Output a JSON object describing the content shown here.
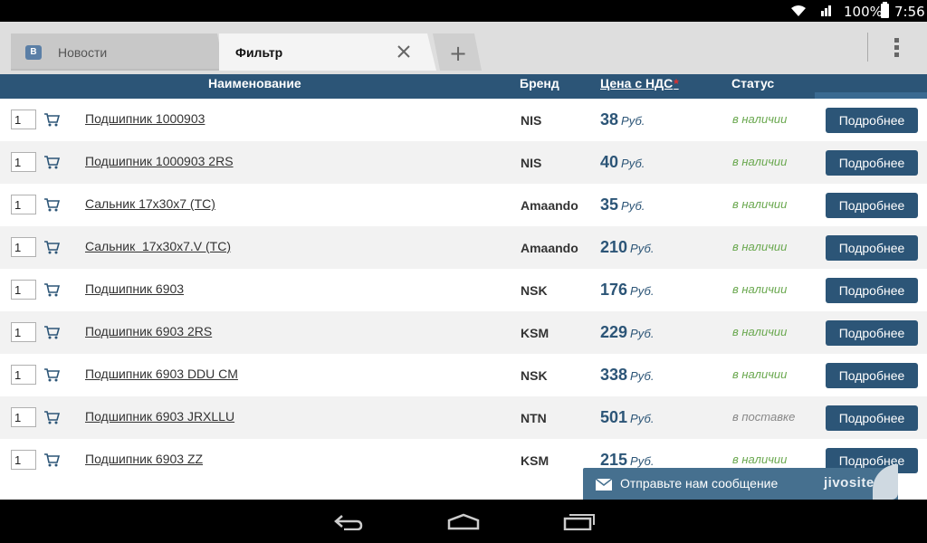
{
  "status_bar": {
    "battery": "100%",
    "time": "7:56"
  },
  "tabs": [
    {
      "label": "Новости",
      "icon": "vk-icon",
      "icon_letter": "В"
    },
    {
      "label": "Фильтр"
    }
  ],
  "table": {
    "headers": {
      "name": "Наименование",
      "brand": "Бренд",
      "price": "Цена с НДС",
      "price_mark": "*",
      "status": "Статус"
    },
    "currency": "Руб.",
    "more_label": "Подробнее",
    "rows": [
      {
        "qty": "1",
        "name": "Подшипник 1000903",
        "brand": "NIS",
        "price": "38",
        "status": "в наличии"
      },
      {
        "qty": "1",
        "name": "Подшипник 1000903 2RS",
        "brand": "NIS",
        "price": "40",
        "status": "в наличии"
      },
      {
        "qty": "1",
        "name": "Сальник 17х30х7 (TC)",
        "brand": "Amaando",
        "price": "35",
        "status": "в наличии"
      },
      {
        "qty": "1",
        "name": "Сальник  17х30х7.V (TC)",
        "brand": "Amaando",
        "price": "210",
        "status": "в наличии"
      },
      {
        "qty": "1",
        "name": "Подшипник 6903",
        "brand": "NSK",
        "price": "176",
        "status": "в наличии"
      },
      {
        "qty": "1",
        "name": "Подшипник 6903 2RS",
        "brand": "KSM",
        "price": "229",
        "status": "в наличии"
      },
      {
        "qty": "1",
        "name": "Подшипник 6903 DDU CM",
        "brand": "NSK",
        "price": "338",
        "status": "в наличии"
      },
      {
        "qty": "1",
        "name": "Подшипник 6903 JRXLLU",
        "brand": "NTN",
        "price": "501",
        "status": "в поставке"
      },
      {
        "qty": "1",
        "name": "Подшипник 6903 ZZ",
        "brand": "KSM",
        "price": "215",
        "status": "в наличии"
      }
    ]
  },
  "jivo": {
    "message": "Отправьте нам сообщение",
    "logo": "jivosite"
  },
  "colors": {
    "header": "#2c5577",
    "available": "#6aa84f",
    "supply": "#888888"
  }
}
